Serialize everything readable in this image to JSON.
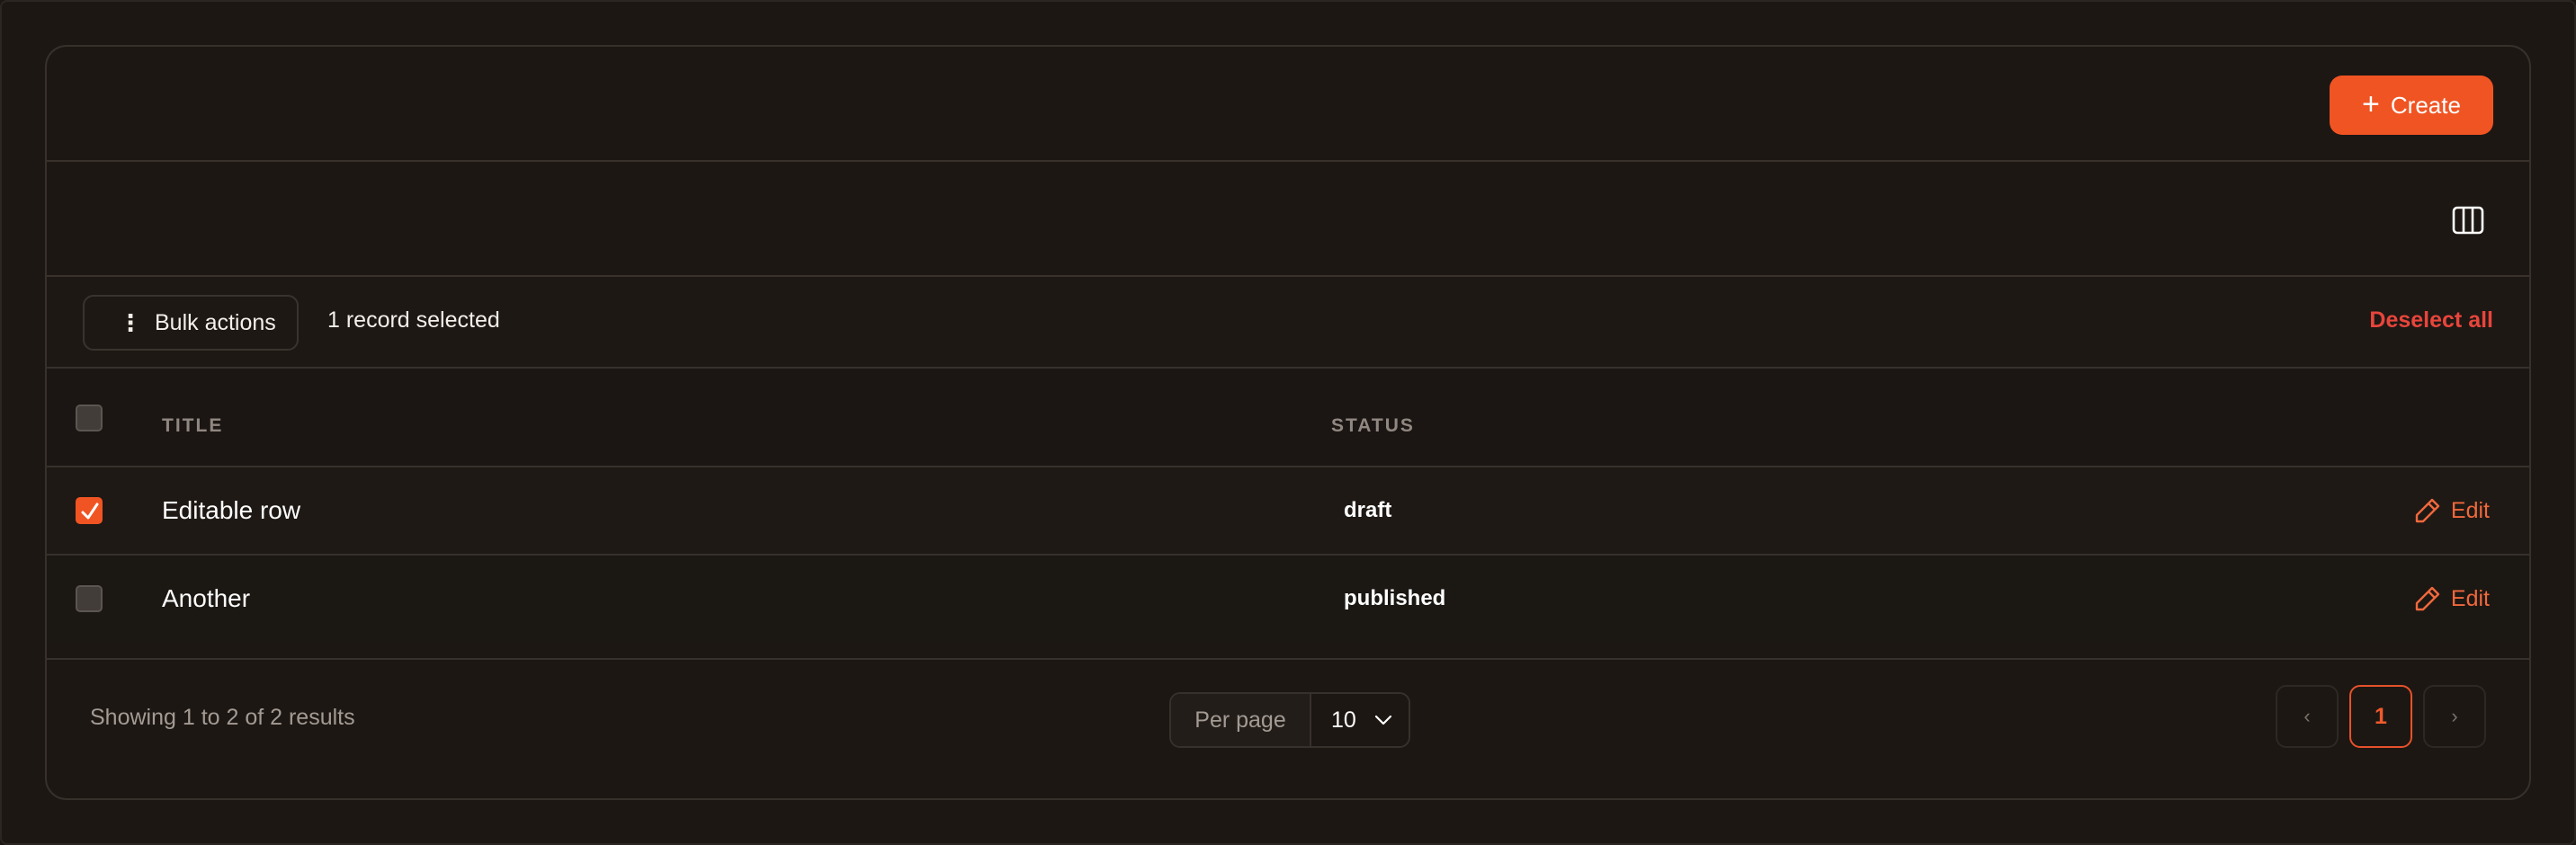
{
  "header": {
    "create_label": "Create",
    "create_icon": "plus-icon"
  },
  "toolbar": {
    "columns_icon": "columns-icon"
  },
  "bulk": {
    "button_label": "Bulk actions",
    "button_icon": "vertical-dots-icon",
    "selected_text": "1 record selected",
    "deselect_label": "Deselect all"
  },
  "table": {
    "columns": [
      "TITLE",
      "STATUS"
    ],
    "rows": [
      {
        "title": "Editable row",
        "status": "draft",
        "checked": true,
        "action": "Edit"
      },
      {
        "title": "Another",
        "status": "published",
        "checked": false,
        "action": "Edit"
      }
    ]
  },
  "footer": {
    "showing_text": "Showing 1 to 2 of 2 results",
    "per_page_label": "Per page",
    "per_page_value": "10",
    "pages": {
      "prev": "‹",
      "current": "1",
      "next": "›"
    }
  },
  "colors": {
    "accent": "#f05423",
    "background": "#1c1713",
    "danger": "#e8453c"
  }
}
